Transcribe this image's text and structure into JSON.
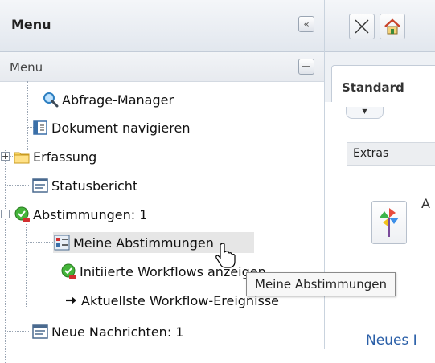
{
  "menu": {
    "title": "Menu",
    "collapse_symbol": "«",
    "subheader": "Menu",
    "minus_symbol": "−"
  },
  "tree": {
    "items": [
      {
        "label": "Abfrage-Manager",
        "icon": "magnifier-icon"
      },
      {
        "label": "Dokument navigieren",
        "icon": "document-navigate-icon"
      },
      {
        "label": "Erfassung",
        "icon": "folder-icon"
      },
      {
        "label": "Statusbericht",
        "icon": "report-icon"
      },
      {
        "label": "Abstimmungen: 1",
        "icon": "approval-check-icon"
      },
      {
        "label": "Meine Abstimmungen",
        "icon": "my-votes-icon"
      },
      {
        "label": "Initiierte Workflows anzeigen",
        "icon": "workflow-check-icon"
      },
      {
        "label": "Aktuellste Workflow-Ereignisse",
        "icon": "arrow-right-icon"
      },
      {
        "label": "Neue Nachrichten: 1",
        "icon": "report-icon"
      }
    ],
    "expander_plus": "+",
    "expander_minus": "−"
  },
  "right": {
    "tab_label": "Standard",
    "dropdown_symbol": "▼",
    "extras_label": "Extras",
    "widget_letter": "A",
    "link_label": "Neues I"
  },
  "tooltip": {
    "text": "Meine Abstimmungen"
  },
  "colors": {
    "selected_row": "#e6e6e6",
    "link": "#2a5fa8"
  }
}
